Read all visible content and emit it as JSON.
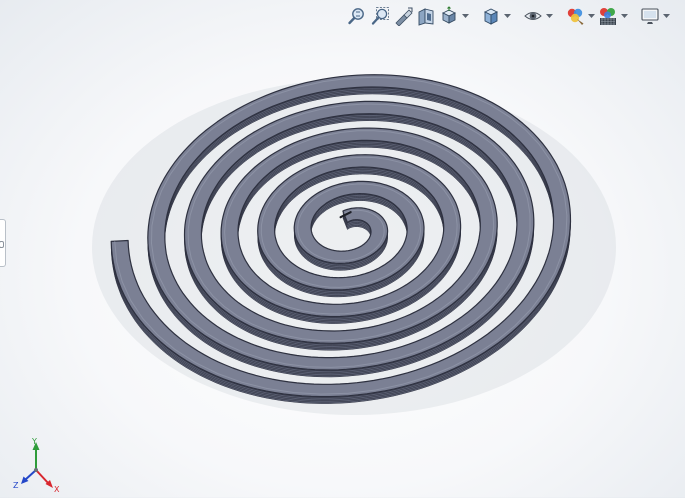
{
  "viewport": {
    "model": "spiral-coil",
    "colors": {
      "top_face": "#7b8094",
      "side_face": "#5a5f72",
      "edge": "#2e3140",
      "background": "#f7f8fa"
    }
  },
  "toolbar": {
    "buttons": [
      {
        "name": "zoom-to-fit-icon",
        "dropdown": false
      },
      {
        "name": "zoom-to-area-icon",
        "dropdown": false
      },
      {
        "name": "previous-view-icon",
        "dropdown": false
      },
      {
        "name": "section-view-icon",
        "dropdown": false
      },
      {
        "name": "view-orientation-icon",
        "dropdown": true
      },
      {
        "name": "display-style-icon",
        "dropdown": true
      },
      {
        "name": "hide-show-items-icon",
        "dropdown": true
      },
      {
        "name": "edit-appearance-icon",
        "dropdown": true
      },
      {
        "name": "apply-scene-icon",
        "dropdown": true
      },
      {
        "name": "view-settings-icon",
        "dropdown": true
      }
    ]
  },
  "triad": {
    "x_label": "X",
    "y_label": "Y",
    "z_label": "Z",
    "colors": {
      "x": "#d8262e",
      "y": "#2e9c3a",
      "z": "#2447c9"
    }
  }
}
